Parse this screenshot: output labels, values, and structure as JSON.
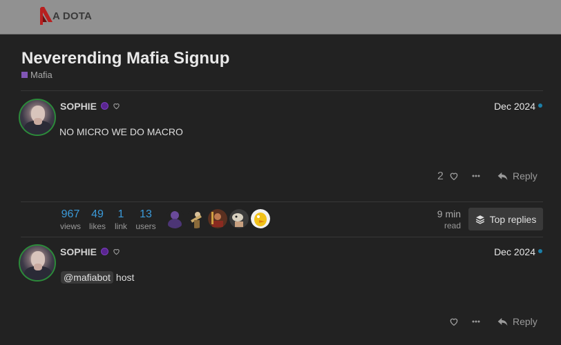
{
  "site": {
    "logo_text": "A DOTA"
  },
  "topic": {
    "title": "Neverending Mafia Signup",
    "category": "Mafia"
  },
  "colors": {
    "category": "#8156b5",
    "link": "#3b9ad9",
    "unread": "#1b7fa8",
    "avatar_ring": "#2c8a3a"
  },
  "posts": [
    {
      "username": "SOPHIE",
      "date": "Dec 2024",
      "text": "NO MICRO WE DO MACRO",
      "mention": "",
      "likes": "2",
      "reply_label": "Reply"
    },
    {
      "username": "SOPHIE",
      "date": "Dec 2024",
      "text": "host",
      "mention": "@mafiabot",
      "likes": "",
      "reply_label": "Reply"
    }
  ],
  "topic_map": {
    "stats": [
      {
        "value": "967",
        "label": "views"
      },
      {
        "value": "49",
        "label": "likes"
      },
      {
        "value": "1",
        "label": "link"
      },
      {
        "value": "13",
        "label": "users"
      }
    ],
    "participant_avatars": [
      "avatar-purple-figure",
      "avatar-telescope",
      "avatar-warrior",
      "avatar-cartoon",
      "avatar-yellow-bird"
    ],
    "read_time": {
      "value": "9 min",
      "label": "read"
    },
    "top_replies_label": "Top replies"
  },
  "icons": {
    "heart": "heart-icon",
    "more": "ellipsis-icon",
    "reply": "reply-arrow-icon",
    "layers": "layers-icon"
  }
}
